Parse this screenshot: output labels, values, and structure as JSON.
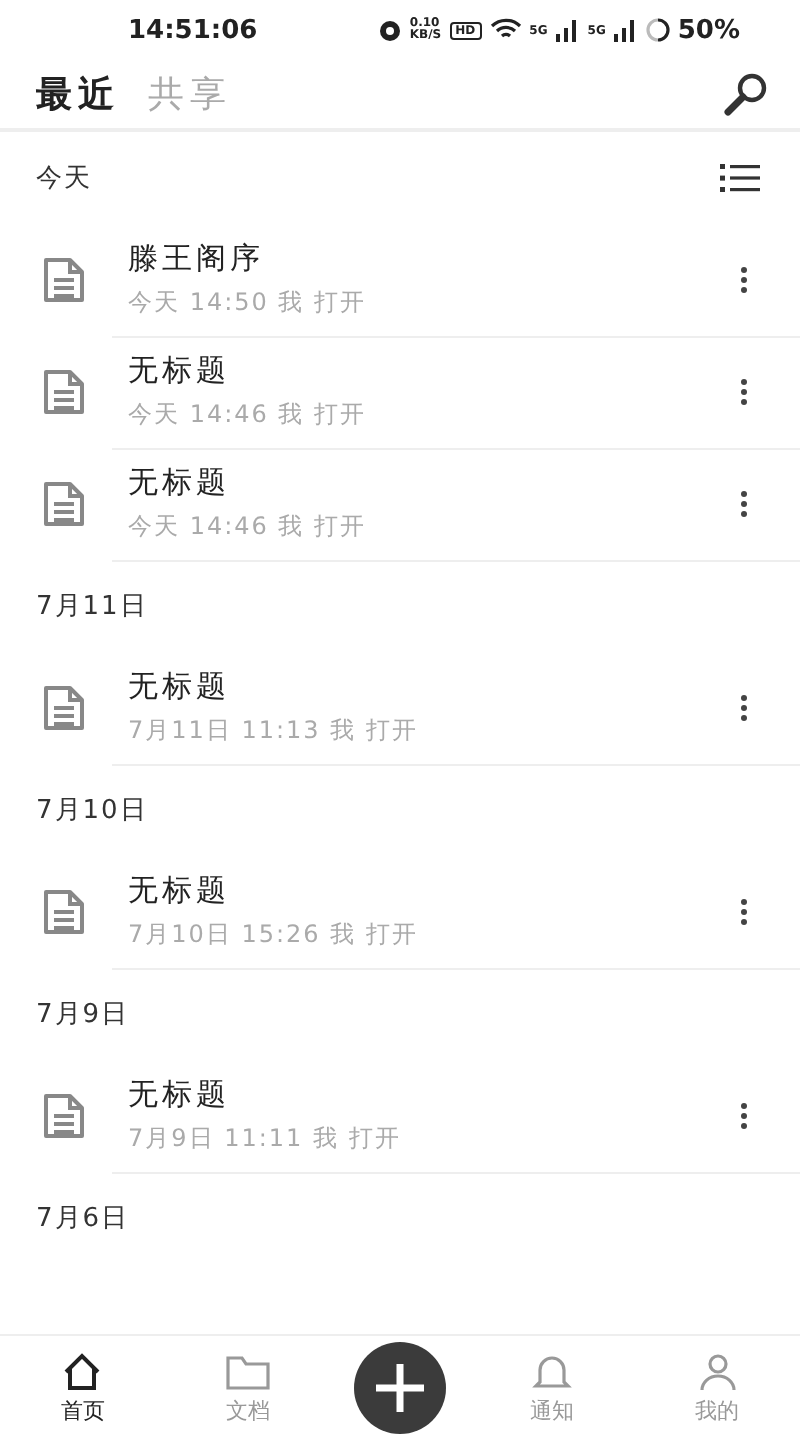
{
  "status_bar": {
    "time": "14:51:06",
    "speed_value": "0.10",
    "speed_unit": "KB/S",
    "hd": "HD",
    "network_1": "5G",
    "network_2": "5G",
    "battery": "50%"
  },
  "header": {
    "tabs": [
      {
        "label": "最近",
        "selected": true
      },
      {
        "label": "共享",
        "selected": false
      }
    ]
  },
  "sections": [
    {
      "title": "今天",
      "items": [
        {
          "title": "滕王阁序",
          "meta": "今天 14:50 我 打开"
        },
        {
          "title": "无标题",
          "meta": "今天 14:46 我 打开"
        },
        {
          "title": "无标题",
          "meta": "今天 14:46 我 打开"
        }
      ]
    },
    {
      "title": "7月11日",
      "items": [
        {
          "title": "无标题",
          "meta": "7月11日 11:13 我 打开"
        }
      ]
    },
    {
      "title": "7月10日",
      "items": [
        {
          "title": "无标题",
          "meta": "7月10日 15:26 我 打开"
        }
      ]
    },
    {
      "title": "7月9日",
      "items": [
        {
          "title": "无标题",
          "meta": "7月9日 11:11 我 打开"
        }
      ]
    },
    {
      "title": "7月6日"
    }
  ],
  "bottom_nav": [
    {
      "kind": "home",
      "label": "首页",
      "selected": true
    },
    {
      "kind": "folder",
      "label": "文档",
      "selected": false
    },
    {
      "kind": "add"
    },
    {
      "kind": "bell",
      "label": "通知",
      "selected": false
    },
    {
      "kind": "user",
      "label": "我的",
      "selected": false
    }
  ]
}
